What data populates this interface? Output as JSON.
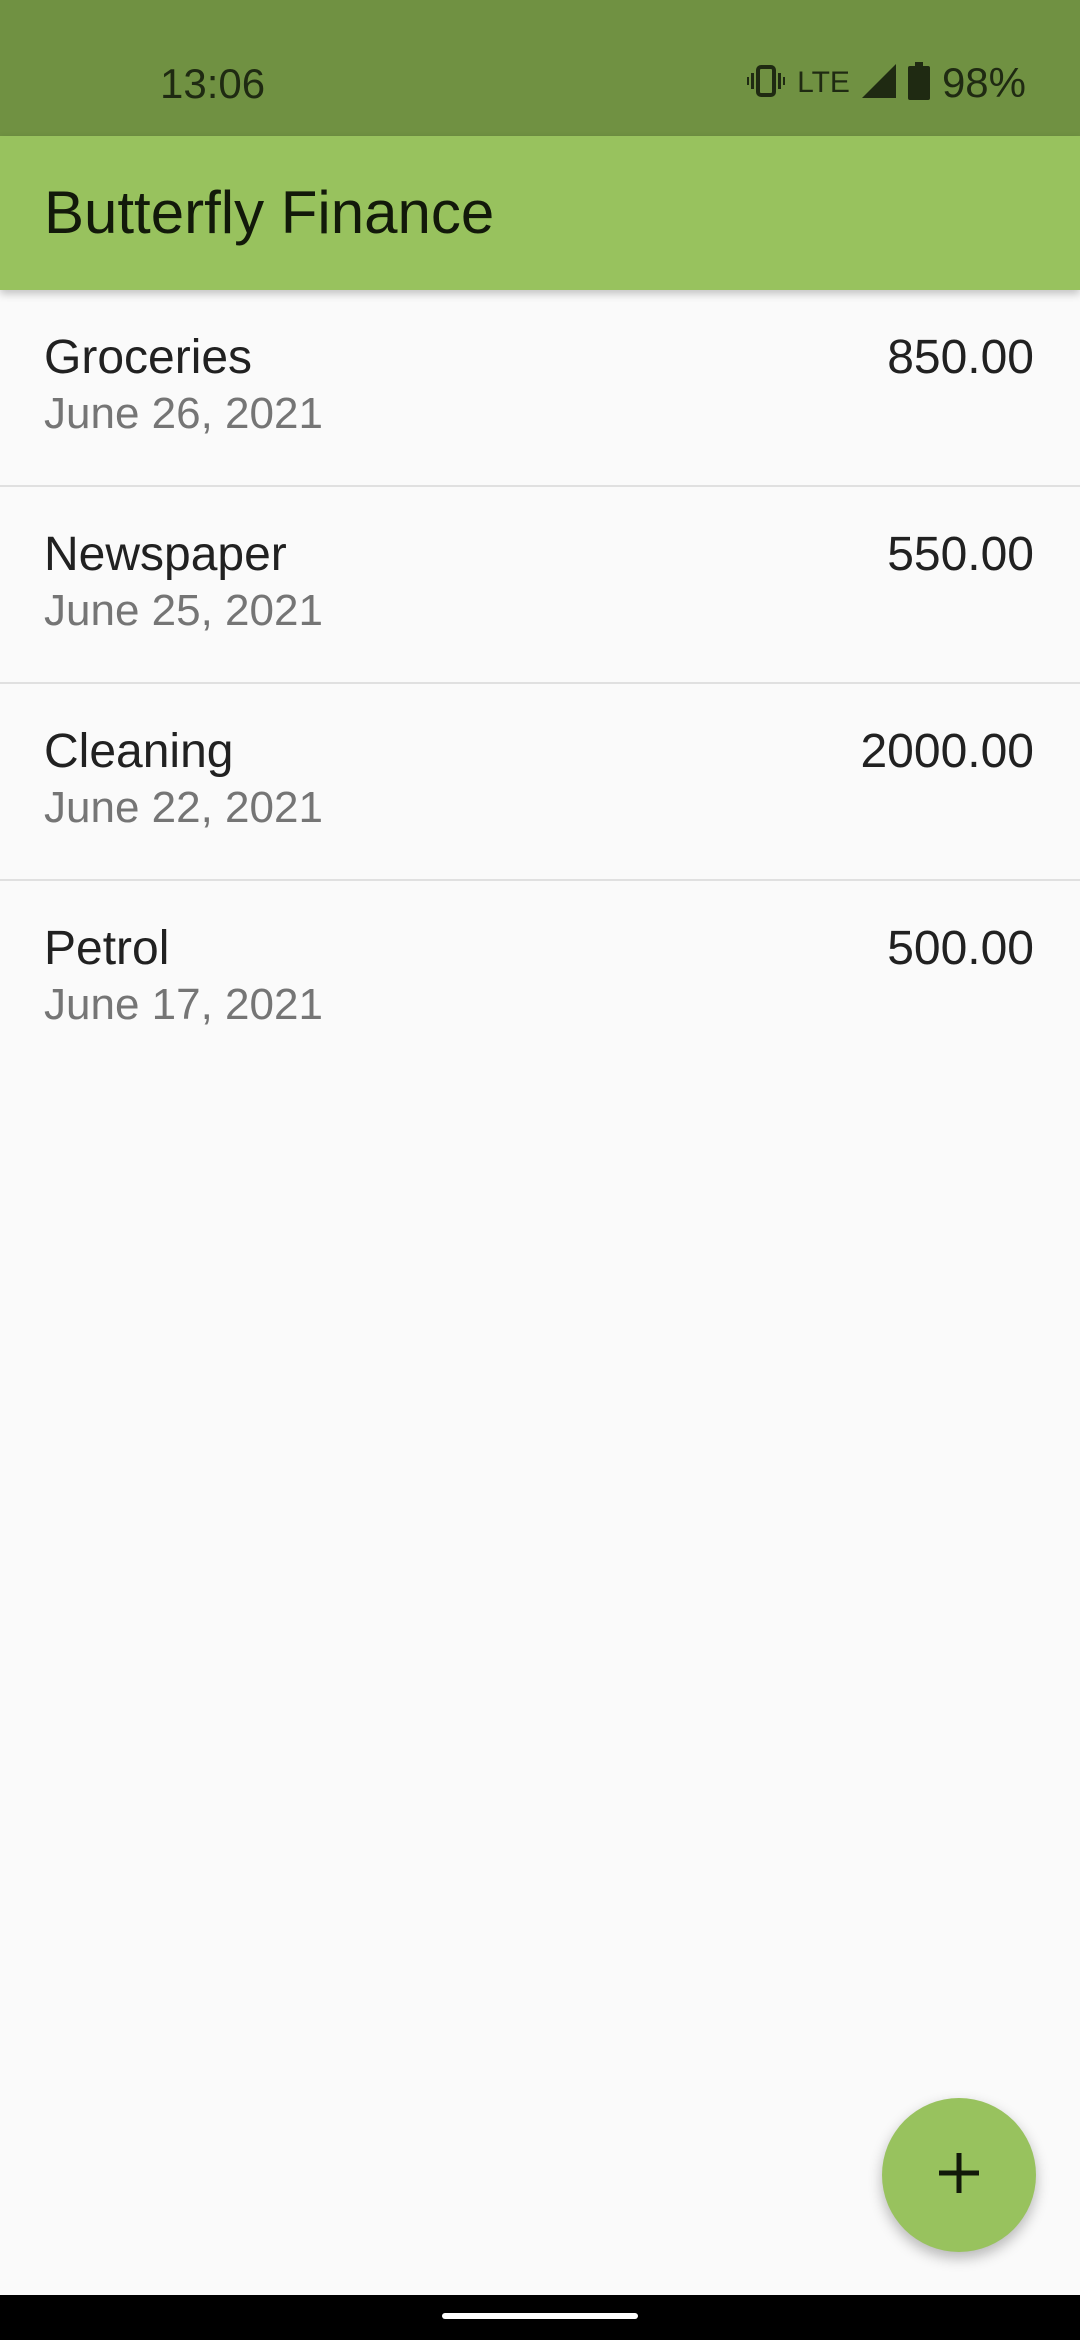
{
  "status_bar": {
    "time": "13:06",
    "network": "LTE",
    "battery": "98%",
    "icons": [
      "vibrate-icon",
      "signal-icon",
      "battery-icon"
    ]
  },
  "app_bar": {
    "title": "Butterfly Finance"
  },
  "transactions": [
    {
      "name": "Groceries",
      "date": "June 26, 2021",
      "amount": "850.00"
    },
    {
      "name": "Newspaper",
      "date": "June 25, 2021",
      "amount": "550.00"
    },
    {
      "name": "Cleaning",
      "date": "June 22, 2021",
      "amount": "2000.00"
    },
    {
      "name": "Petrol",
      "date": "June 17, 2021",
      "amount": "500.00"
    }
  ],
  "fab": {
    "icon": "plus-icon"
  },
  "colors": {
    "status_bar": "#709142",
    "app_bar": "#98c25e",
    "fab": "#98c25e",
    "background": "#fafafa"
  }
}
